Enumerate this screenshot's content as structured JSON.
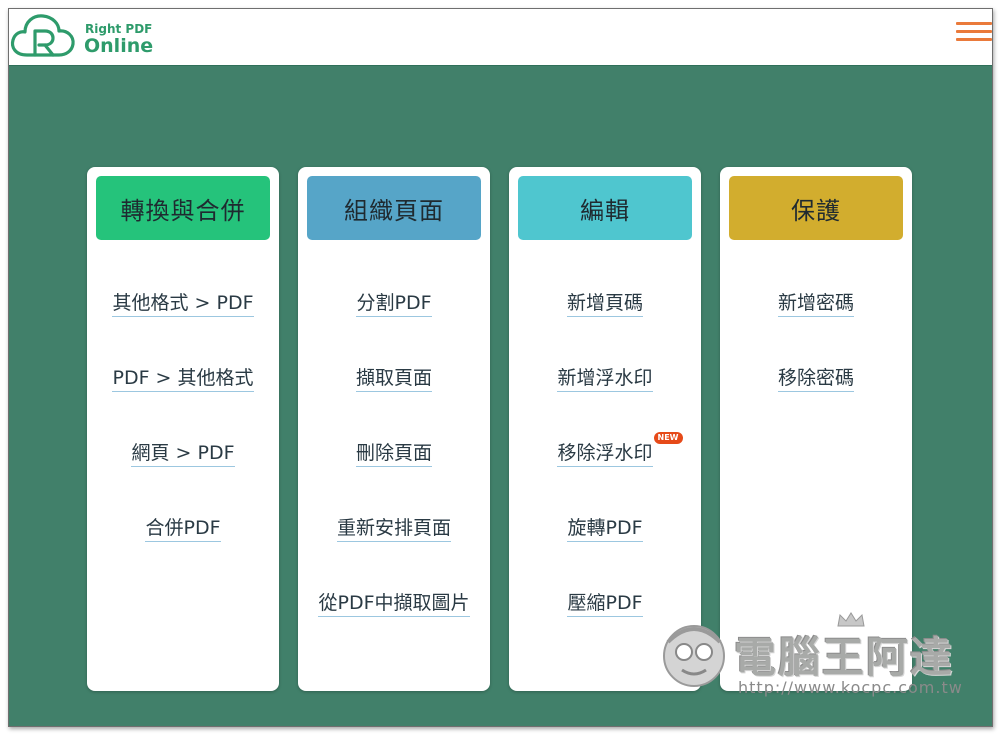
{
  "app": {
    "logo_line1": "Right PDF",
    "logo_line2": "Online",
    "brand_color": "#2e9b6b",
    "menu_icon": "hamburger-menu-icon",
    "menu_color": "#ea7a3b",
    "background_color": "#41806a"
  },
  "categories": [
    {
      "title": "轉換與合併",
      "color": "#25c37b",
      "links": [
        "其他格式 > PDF",
        "PDF > 其他格式",
        "網頁 > PDF",
        "合併PDF"
      ]
    },
    {
      "title": "組織頁面",
      "color": "#56a5c8",
      "links": [
        "分割PDF",
        "擷取頁面",
        "刪除頁面",
        "重新安排頁面",
        "從PDF中擷取圖片"
      ]
    },
    {
      "title": "編輯",
      "color": "#4fc6cf",
      "links": [
        "新增頁碼",
        "新增浮水印",
        "移除浮水印",
        "旋轉PDF",
        "壓縮PDF"
      ],
      "badge": "NEW"
    },
    {
      "title": "保護",
      "color": "#d2ad2e",
      "links": [
        "新增密碼",
        "移除密碼"
      ]
    }
  ],
  "watermark": {
    "title": "電腦王阿達",
    "url": "http://www.kocpc.com.tw"
  }
}
